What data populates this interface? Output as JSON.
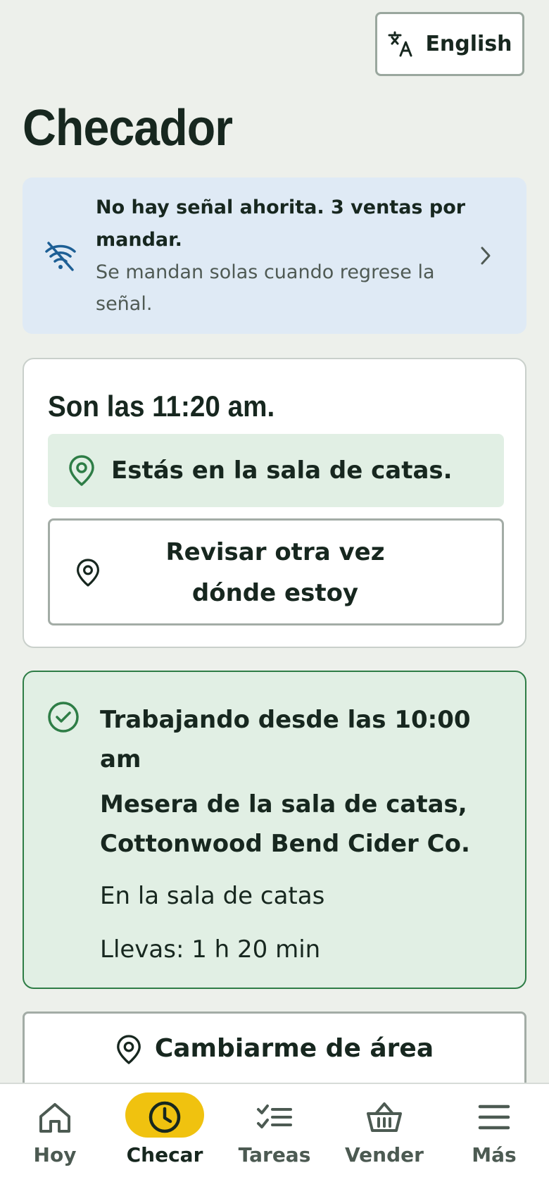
{
  "header": {
    "language_button_label": "English",
    "language_icon": "translate-icon",
    "page_title": "Checador"
  },
  "offline_banner": {
    "icon": "wifi-off-icon",
    "title": "No hay señal ahorita. 3 ventas por mandar.",
    "subtitle": "Se mandan solas cuando regrese la señal.",
    "chevron": "chevron-right-icon",
    "background_color": "#dfeaf5"
  },
  "time_card": {
    "time_text": "Son las 11:20 am.",
    "location_status": "Estás en la sala de catas.",
    "recheck_button_label": "Revisar otra vez dónde estoy"
  },
  "working_card": {
    "title": "Trabajando desde las 10:00 am",
    "role": "Mesera de la sala de catas, Cottonwood Bend Cider Co.",
    "area": "En la sala de catas",
    "elapsed": "Llevas: 1 h 20 min",
    "accent_color": "#2e7d46",
    "background_color": "#e1efe4"
  },
  "change_area_button_label": "Cambiarme de área",
  "bottom_nav": {
    "active_color": "#f0c20f",
    "items": [
      {
        "label": "Hoy",
        "icon": "home-icon"
      },
      {
        "label": "Checar",
        "icon": "clock-icon",
        "active": true
      },
      {
        "label": "Tareas",
        "icon": "checklist-icon"
      },
      {
        "label": "Vender",
        "icon": "basket-icon"
      },
      {
        "label": "Más",
        "icon": "menu-icon"
      }
    ]
  }
}
